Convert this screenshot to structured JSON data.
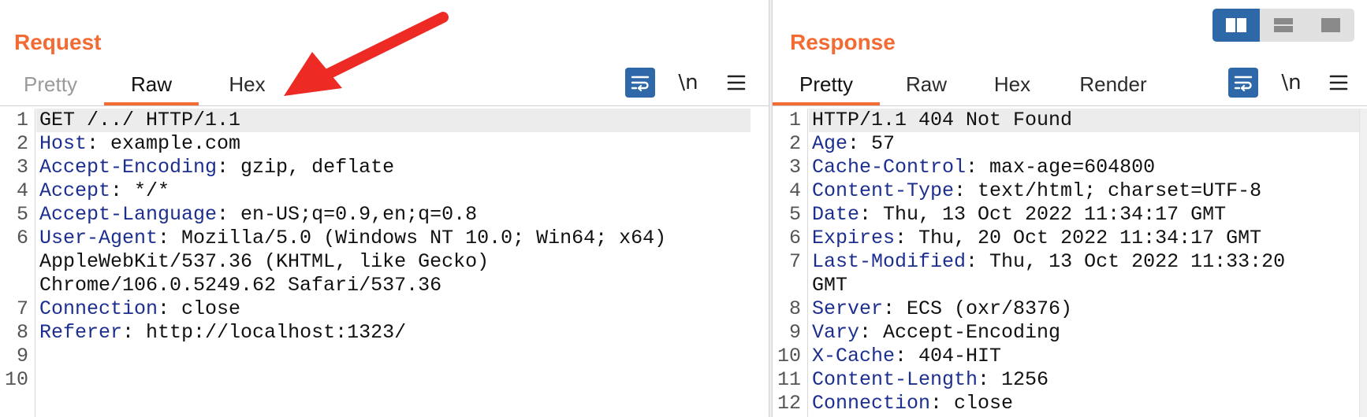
{
  "request": {
    "title": "Request",
    "tabs": [
      {
        "label": "Pretty",
        "state": "disabled"
      },
      {
        "label": "Raw",
        "state": "active"
      },
      {
        "label": "Hex",
        "state": "normal"
      }
    ],
    "toolbar": {
      "wrap_icon": "wrap-lines-icon",
      "newline_label": "\\n",
      "menu_icon": "hamburger-menu-icon"
    },
    "lines": [
      {
        "num": "1",
        "code": "GET /../ HTTP/1.1"
      },
      {
        "num": "2",
        "name": "Host",
        "value": ": example.com"
      },
      {
        "num": "3",
        "name": "Accept-Encoding",
        "value": ": gzip, deflate"
      },
      {
        "num": "4",
        "name": "Accept",
        "value": ": */*"
      },
      {
        "num": "5",
        "name": "Accept-Language",
        "value": ": en-US;q=0.9,en;q=0.8"
      },
      {
        "num": "6",
        "name": "User-Agent",
        "value": ": Mozilla/5.0 (Windows NT 10.0; Win64; x64)"
      },
      {
        "num": "",
        "code": "AppleWebKit/537.36 (KHTML, like Gecko)"
      },
      {
        "num": "",
        "code": "Chrome/106.0.5249.62 Safari/537.36"
      },
      {
        "num": "7",
        "name": "Connection",
        "value": ": close"
      },
      {
        "num": "8",
        "name": "Referer",
        "value": ": http://localhost:1323/"
      },
      {
        "num": "9",
        "code": ""
      },
      {
        "num": "10",
        "code": ""
      }
    ]
  },
  "response": {
    "title": "Response",
    "tabs": [
      {
        "label": "Pretty",
        "state": "active"
      },
      {
        "label": "Raw",
        "state": "normal"
      },
      {
        "label": "Hex",
        "state": "normal"
      },
      {
        "label": "Render",
        "state": "normal"
      }
    ],
    "toolbar": {
      "wrap_icon": "wrap-lines-icon",
      "newline_label": "\\n",
      "menu_icon": "hamburger-menu-icon"
    },
    "lines": [
      {
        "num": "1",
        "code": "HTTP/1.1 404 Not Found"
      },
      {
        "num": "2",
        "name": "Age",
        "value": ": 57"
      },
      {
        "num": "3",
        "name": "Cache-Control",
        "value": ": max-age=604800"
      },
      {
        "num": "4",
        "name": "Content-Type",
        "value": ": text/html; charset=UTF-8"
      },
      {
        "num": "5",
        "name": "Date",
        "value": ": Thu, 13 Oct 2022 11:34:17 GMT"
      },
      {
        "num": "6",
        "name": "Expires",
        "value": ": Thu, 20 Oct 2022 11:34:17 GMT"
      },
      {
        "num": "7",
        "name": "Last-Modified",
        "value": ": Thu, 13 Oct 2022 11:33:20"
      },
      {
        "num": "",
        "code": "GMT"
      },
      {
        "num": "8",
        "name": "Server",
        "value": ": ECS (oxr/8376)"
      },
      {
        "num": "9",
        "name": "Vary",
        "value": ": Accept-Encoding"
      },
      {
        "num": "10",
        "name": "X-Cache",
        "value": ": 404-HIT"
      },
      {
        "num": "11",
        "name": "Content-Length",
        "value": ": 1256"
      },
      {
        "num": "12",
        "name": "Connection",
        "value": ": close"
      }
    ]
  },
  "layout_controls": [
    {
      "name": "side-by-side-layout-icon",
      "state": "active"
    },
    {
      "name": "stacked-layout-icon",
      "state": "normal"
    },
    {
      "name": "single-pane-layout-icon",
      "state": "normal"
    }
  ],
  "annotation": {
    "arrow_icon": "red-arrow-icon",
    "color": "#ee2a24"
  },
  "colors": {
    "accent": "#f26b33",
    "header_name": "#1c2f8f",
    "button_blue": "#2f68a8"
  }
}
